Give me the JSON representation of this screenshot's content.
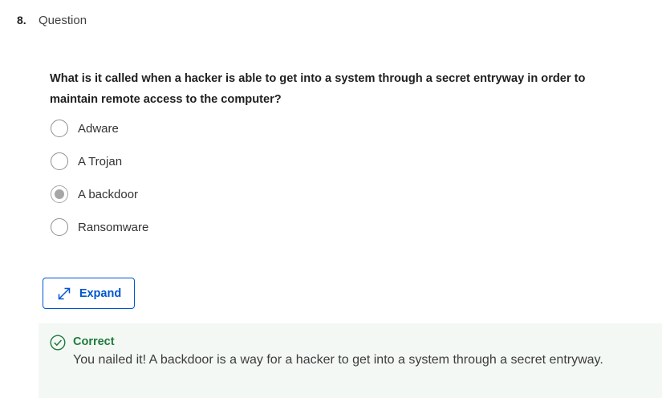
{
  "question": {
    "number": "8.",
    "label": "Question",
    "text": "What is it called when a hacker is able to get into a system through a secret entryway in order to maintain remote access to the computer?"
  },
  "options": [
    {
      "label": "Adware",
      "selected": false
    },
    {
      "label": "A Trojan",
      "selected": false
    },
    {
      "label": "A backdoor",
      "selected": true
    },
    {
      "label": "Ransomware",
      "selected": false
    }
  ],
  "expand_button": {
    "label": "Expand",
    "icon": "expand-arrows-icon"
  },
  "feedback": {
    "status": "Correct",
    "message": "You nailed it! A backdoor is a way for a hacker to get into a system through a secret entryway.",
    "icon": "check-circle-icon",
    "color": "#1e7a3a",
    "background": "#f3f8f4"
  },
  "colors": {
    "accent": "#0056d2",
    "selected_radio": "#a6a6a6"
  }
}
